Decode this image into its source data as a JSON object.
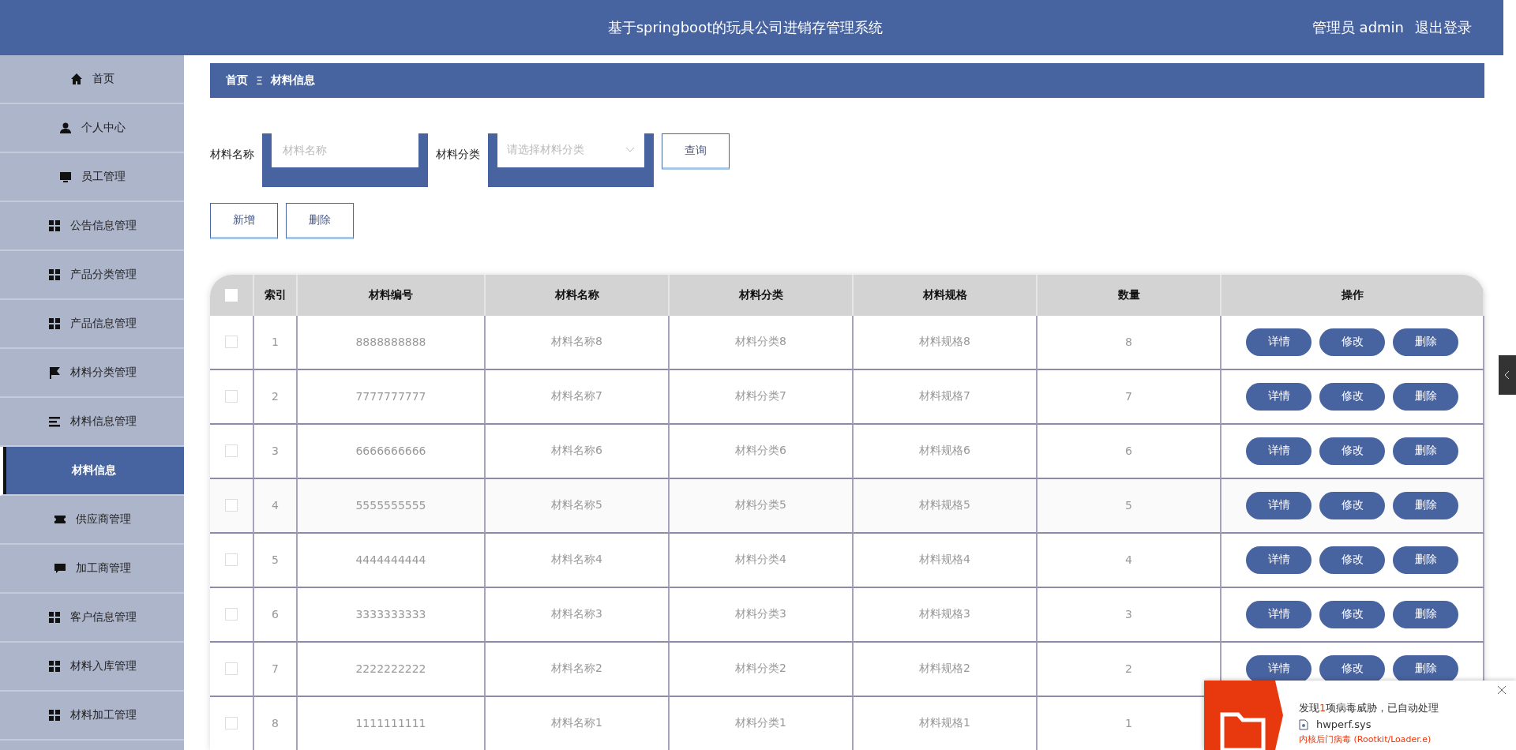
{
  "header": {
    "title": "基于springboot的玩具公司进销存管理系统",
    "user": "管理员 admin",
    "logout": "退出登录"
  },
  "sidebar": {
    "items": [
      {
        "label": "首页",
        "kind": "home",
        "selected": false
      },
      {
        "label": "个人中心",
        "kind": "person",
        "selected": false
      },
      {
        "label": "员工管理",
        "kind": "monitor",
        "selected": false
      },
      {
        "label": "公告信息管理",
        "kind": "grid",
        "selected": false
      },
      {
        "label": "产品分类管理",
        "kind": "grid",
        "selected": false
      },
      {
        "label": "产品信息管理",
        "kind": "grid",
        "selected": false
      },
      {
        "label": "材料分类管理",
        "kind": "flag",
        "selected": false
      },
      {
        "label": "材料信息管理",
        "kind": "lines",
        "selected": false,
        "children": [
          {
            "label": "材料信息",
            "selected": true
          }
        ]
      },
      {
        "label": "供应商管理",
        "kind": "ticket",
        "selected": false
      },
      {
        "label": "加工商管理",
        "kind": "chat",
        "selected": false
      },
      {
        "label": "客户信息管理",
        "kind": "grid",
        "selected": false
      },
      {
        "label": "材料入库管理",
        "kind": "grid",
        "selected": false
      },
      {
        "label": "材料加工管理",
        "kind": "grid",
        "selected": false
      }
    ]
  },
  "breadcrumb": {
    "home": "首页",
    "separator": "Ξ",
    "current": "材料信息"
  },
  "search": {
    "fields": [
      {
        "kind": "text",
        "label": "材料名称",
        "placeholder": "材料名称"
      },
      {
        "kind": "select",
        "label": "材料分类",
        "placeholder": "请选择材料分类"
      }
    ],
    "button": "查询"
  },
  "actions": [
    "新增",
    "删除"
  ],
  "table": {
    "select_all_checked": false,
    "columns": [
      "索引",
      "材料编号",
      "材料名称",
      "材料分类",
      "材料规格",
      "数量",
      "操作"
    ],
    "rows": [
      {
        "checked": false,
        "cells": [
          "1",
          "8888888888",
          "材料名称8",
          "材料分类8",
          "材料规格8",
          "8"
        ],
        "buttons": [
          "详情",
          "修改",
          "删除"
        ]
      },
      {
        "checked": false,
        "cells": [
          "2",
          "7777777777",
          "材料名称7",
          "材料分类7",
          "材料规格7",
          "7"
        ],
        "buttons": [
          "详情",
          "修改",
          "删除"
        ]
      },
      {
        "checked": false,
        "cells": [
          "3",
          "6666666666",
          "材料名称6",
          "材料分类6",
          "材料规格6",
          "6"
        ],
        "buttons": [
          "详情",
          "修改",
          "删除"
        ]
      },
      {
        "checked": false,
        "cells": [
          "4",
          "5555555555",
          "材料名称5",
          "材料分类5",
          "材料规格5",
          "5"
        ],
        "buttons": [
          "详情",
          "修改",
          "删除"
        ]
      },
      {
        "checked": false,
        "cells": [
          "5",
          "4444444444",
          "材料名称4",
          "材料分类4",
          "材料规格4",
          "4"
        ],
        "buttons": [
          "详情",
          "修改",
          "删除"
        ]
      },
      {
        "checked": false,
        "cells": [
          "6",
          "3333333333",
          "材料名称3",
          "材料分类3",
          "材料规格3",
          "3"
        ],
        "buttons": [
          "详情",
          "修改",
          "删除"
        ]
      },
      {
        "checked": false,
        "cells": [
          "7",
          "2222222222",
          "材料名称2",
          "材料分类2",
          "材料规格2",
          "2"
        ],
        "buttons": [
          "详情",
          "修改",
          "删除"
        ]
      },
      {
        "checked": false,
        "cells": [
          "8",
          "1111111111",
          "材料名称1",
          "材料分类1",
          "材料规格1",
          "1"
        ]
      }
    ]
  },
  "notification": {
    "prefix": "发现",
    "count": "1",
    "suffix": "项病毒威胁，已自动处理",
    "file": "hwperf.sys",
    "threat": "内核后门病毒 (Rootkit/Loader.e)"
  }
}
